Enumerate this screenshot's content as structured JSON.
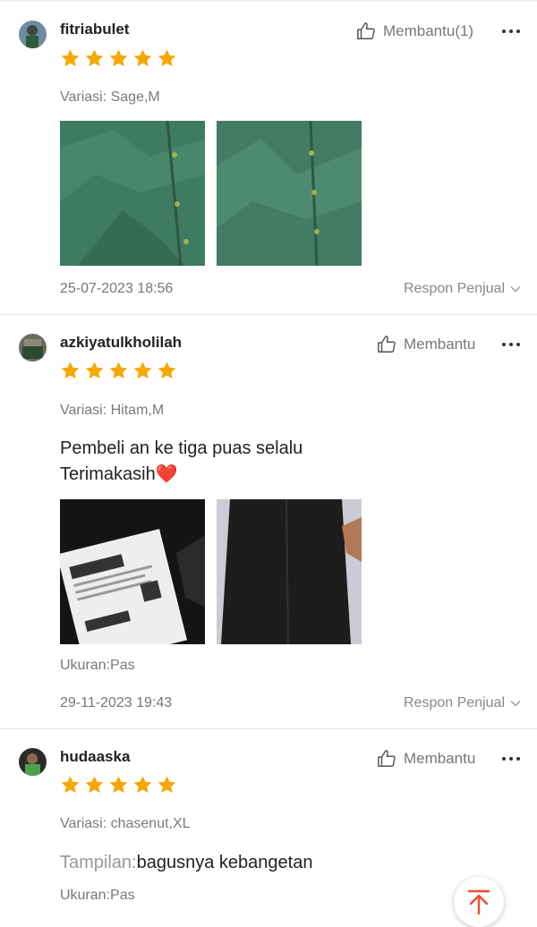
{
  "reviews": [
    {
      "username": "fitriabulet",
      "helpful_label": "Membantu(1)",
      "rating": 5,
      "variation": "Variasi: Sage,M",
      "comment_lines": [],
      "photos": [
        "green-shirt-photo-1",
        "green-shirt-photo-2"
      ],
      "date": "25-07-2023 18:56",
      "seller_response": "Respon Penjual"
    },
    {
      "username": "azkiyatulkholilah",
      "helpful_label": "Membantu",
      "rating": 5,
      "variation": "Variasi: Hitam,M",
      "comment_lines": [
        "Pembeli an ke tiga puas selalu",
        "Terimakasih❤️"
      ],
      "photos": [
        "package-label-photo",
        "black-shirt-photo"
      ],
      "size_note": "Ukuran:Pas",
      "date": "29-11-2023 19:43",
      "seller_response": "Respon Penjual"
    },
    {
      "username": "hudaaska",
      "helpful_label": "Membantu",
      "rating": 5,
      "variation": "Variasi: chasenut,XL",
      "appearance_label": "Tampilan:",
      "appearance_value": "bagusnya kebangetan",
      "size_note": "Ukuran:Pas"
    }
  ],
  "colors": {
    "star": "#f6a700",
    "accent": "#ee4d2d",
    "muted": "#777777"
  },
  "icons": {
    "helpful": "thumbs-up-icon",
    "more": "more-dots-icon",
    "chevron": "chevron-down-icon",
    "top": "back-to-top-icon"
  }
}
